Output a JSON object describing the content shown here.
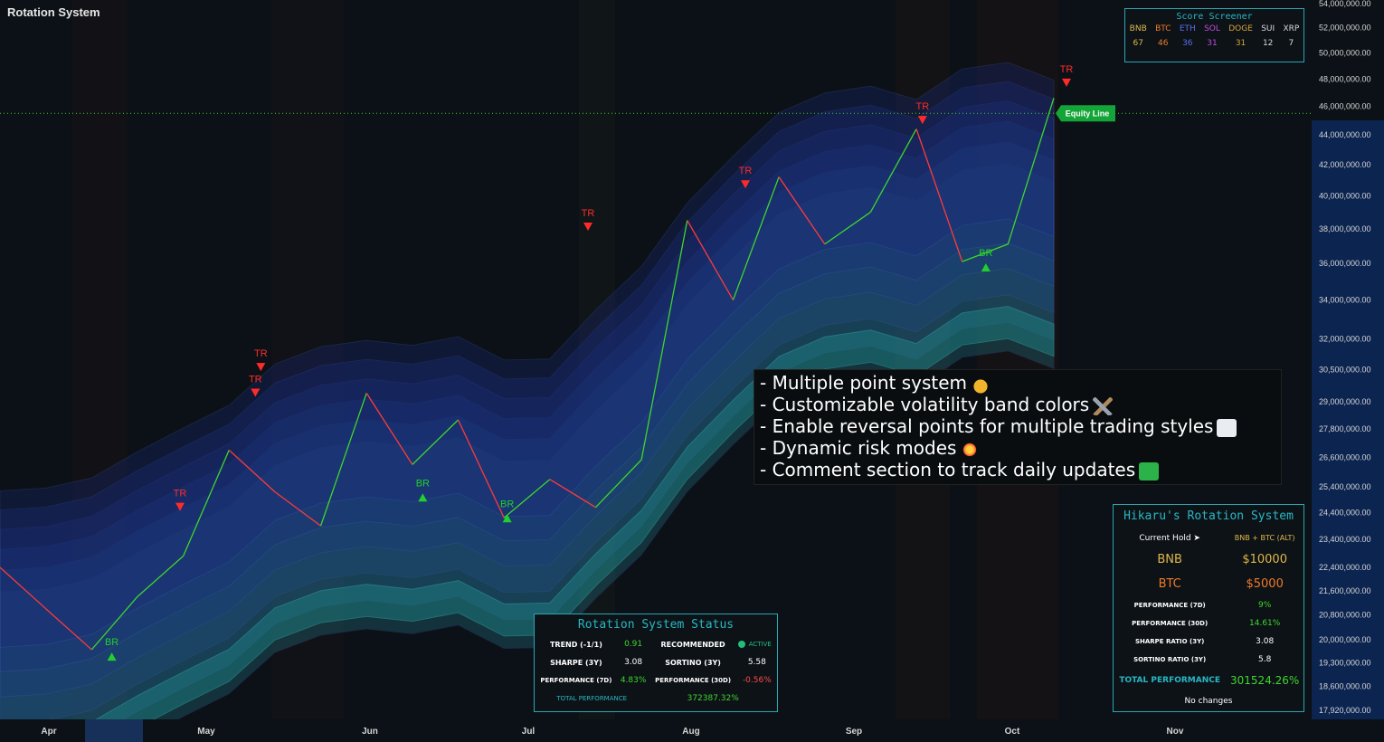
{
  "title": "Rotation System",
  "chart_data": {
    "type": "line",
    "x": [
      "Apr",
      "May",
      "Jun",
      "Jul",
      "Aug",
      "Sep",
      "Oct"
    ],
    "y_ticks": [
      "54,000,000.00",
      "52,000,000.00",
      "50,000,000.00",
      "48,000,000.00",
      "46,000,000.00",
      "44,000,000.00",
      "42,000,000.00",
      "40,000,000.00",
      "38,000,000.00",
      "36,000,000.00",
      "34,000,000.00",
      "32,000,000.00",
      "30,500,000.00",
      "29,000,000.00",
      "27,800,000.00",
      "26,600,000.00",
      "25,400,000.00",
      "24,400,000.00",
      "23,400,000.00",
      "22,400,000.00",
      "21,600,000.00",
      "20,800,000.00",
      "20,000,000.00",
      "19,300,000.00",
      "18,600,000.00",
      "17,920,000.00"
    ],
    "x_ticks": [
      "Apr",
      "May",
      "Jun",
      "Jul",
      "Aug",
      "Sep",
      "Oct",
      "Nov"
    ],
    "series": [
      {
        "name": "Equity Line",
        "values": [
          22400000,
          21000000,
          19700000,
          21400000,
          22800000,
          26900000,
          25200000,
          23900000,
          29400000,
          26300000,
          28200000,
          24200000,
          25700000,
          24600000,
          26500000,
          38500000,
          34000000,
          41200000,
          37100000,
          39000000,
          44400000,
          36100000,
          37100000,
          46600000
        ]
      }
    ],
    "equity_line_value": 45500000,
    "markers": [
      {
        "label": "TR",
        "x": "Apr 26",
        "y": 24600000
      },
      {
        "label": "TR",
        "x": "May 10",
        "y": 29400000
      },
      {
        "label": "TR",
        "x": "May 11",
        "y": 30600000
      },
      {
        "label": "BR",
        "x": "Apr 13",
        "y": 19500000
      },
      {
        "label": "BR",
        "x": "Jun 11",
        "y": 25000000
      },
      {
        "label": "BR",
        "x": "Jun 27",
        "y": 24200000
      },
      {
        "label": "TR",
        "x": "Jul 12",
        "y": 38100000
      },
      {
        "label": "TR",
        "x": "Aug 11",
        "y": 40700000
      },
      {
        "label": "TR",
        "x": "Sep 14",
        "y": 45000000
      },
      {
        "label": "BR",
        "x": "Sep 26",
        "y": 35800000
      },
      {
        "label": "TR",
        "x": "Oct 11",
        "y": 47700000
      }
    ],
    "tag": "Equity Line",
    "grid": false
  },
  "score_screener": {
    "title": "Score Screener",
    "assets": [
      {
        "name": "BNB",
        "score": "67",
        "color": "#e0b84a"
      },
      {
        "name": "BTC",
        "score": "46",
        "color": "#f07a2a"
      },
      {
        "name": "ETH",
        "score": "36",
        "color": "#5b6cf0"
      },
      {
        "name": "SOL",
        "score": "31",
        "color": "#c04be0"
      },
      {
        "name": "DOGE",
        "score": "31",
        "color": "#d6a63a"
      },
      {
        "name": "SUI",
        "score": "12",
        "color": "#d9d9d9"
      },
      {
        "name": "XRP",
        "score": "7",
        "color": "#d9d9d9"
      }
    ]
  },
  "features": [
    "- Multiple point system",
    "- Customizable volatility band colors",
    "- Enable reversal points for multiple trading styles",
    "- Dynamic risk modes",
    "- Comment section to track daily updates"
  ],
  "status": {
    "title": "Rotation System Status",
    "trend_label": "TREND (-1/1)",
    "trend_value": "0.91",
    "recommended_label": "RECOMMENDED",
    "recommended_value": "ACTIVE",
    "sharpe_label": "SHARPE (3Y)",
    "sharpe_value": "3.08",
    "sortino_label": "SORTINO (3Y)",
    "sortino_value": "5.58",
    "perf7_label": "PERFORMANCE (7D)",
    "perf7_value": "4.83%",
    "perf30_label": "PERFORMANCE (30D)",
    "perf30_value": "-0.56%",
    "total_label": "TOTAL PERFORMANCE",
    "total_value": "372387.32%"
  },
  "hikaru": {
    "title": "Hikaru's Rotation System",
    "hold_label": "Current Hold ➤",
    "hold_value": "BNB + BTC (ALT)",
    "a1_name": "BNB",
    "a1_value": "$10000",
    "a2_name": "BTC",
    "a2_value": "$5000",
    "perf7_label": "PERFORMANCE (7D)",
    "perf7_value": "9%",
    "perf30_label": "PERFORMANCE (30D)",
    "perf30_value": "14.61%",
    "sharpe_label": "SHARPE RATIO (3Y)",
    "sharpe_value": "3.08",
    "sortino_label": "SORTINO RATIO (3Y)",
    "sortino_value": "5.8",
    "total_label": "TOTAL PERFORMANCE",
    "total_value": "301524.26%",
    "footer": "No changes"
  },
  "colors": {
    "up": "#3fd62c",
    "down": "#ff3a3a",
    "neutral": "#c8c8c8",
    "band_top": "#1a2a7a",
    "band_bottom": "#1f8a8a",
    "axis_bg": "#0c2450",
    "tag": "#13a537"
  }
}
